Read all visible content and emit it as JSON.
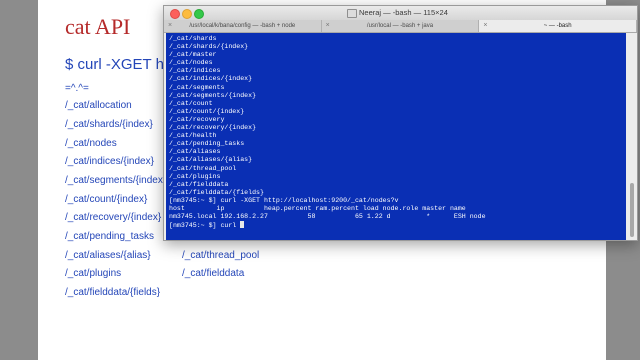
{
  "slide": {
    "title": "cat API",
    "command": "$ curl -XGET http",
    "cat_face": "=^.^=",
    "endpoints_col1": [
      "/_cat/allocation",
      "/_cat/shards/{index}",
      "/_cat/nodes",
      "/_cat/indices/{index}",
      "/_cat/segments/{index}",
      "/_cat/count/{index}",
      "/_cat/recovery/{index}",
      "/_cat/pending_tasks",
      "/_cat/aliases/{alias}",
      "/_cat/plugins",
      "/_cat/fielddata/{fields}"
    ],
    "endpoints_col2": [
      "/_cat/thread_pool",
      "/_cat/fielddata"
    ]
  },
  "terminal": {
    "window_title": "Neeraj — -bash — 115×24",
    "tabs": [
      {
        "label": "/usr/local/k/bana/config — -bash + node"
      },
      {
        "label": "/usr/local — -bash + java"
      },
      {
        "label": "~ — -bash"
      }
    ],
    "lines": [
      "/_cat/shards",
      "/_cat/shards/{index}",
      "/_cat/master",
      "/_cat/nodes",
      "/_cat/indices",
      "/_cat/indices/{index}",
      "/_cat/segments",
      "/_cat/segments/{index}",
      "/_cat/count",
      "/_cat/count/{index}",
      "/_cat/recovery",
      "/_cat/recovery/{index}",
      "/_cat/health",
      "/_cat/pending_tasks",
      "/_cat/aliases",
      "/_cat/aliases/{alias}",
      "/_cat/thread_pool",
      "/_cat/plugins",
      "/_cat/fielddata",
      "/_cat/fielddata/{fields}",
      "[nm3745:~ $] curl -XGET http://localhost:9200/_cat/nodes?v",
      "host        ip          heap.percent ram.percent load node.role master name",
      "nm3745.local 192.168.2.27          58          65 1.22 d         *      ESH node"
    ],
    "prompt_line": "[nm3745:~ $] curl "
  }
}
